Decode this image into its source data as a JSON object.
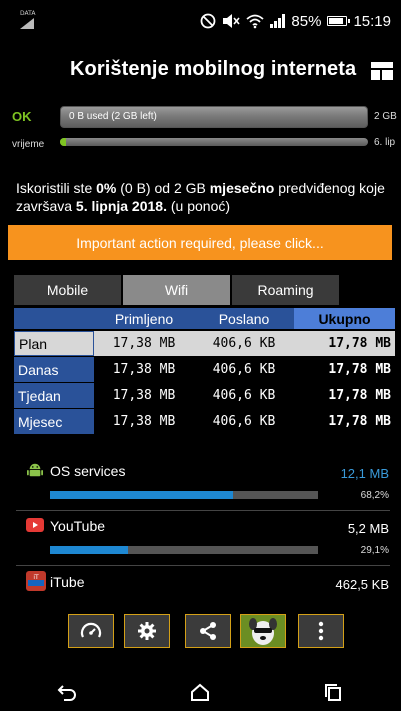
{
  "status_bar": {
    "data_label": "DATA",
    "battery": "85%",
    "battery_level": 0.85,
    "time": "15:19",
    "icons": [
      "data-icon",
      "do-not-disturb-icon",
      "mute-icon",
      "wifi-icon",
      "signal-icon",
      "battery-icon"
    ]
  },
  "header": {
    "title": "Korištenje mobilnog interneta",
    "menu_icon": "layout-icon"
  },
  "usage": {
    "status": "OK",
    "used_text": "0 B used (2 GB left)",
    "limit": "2 GB",
    "time_label": "vrijeme",
    "time_end": "6. lip",
    "used_fraction": 0.0,
    "time_fraction": 0.0
  },
  "description": {
    "part1": "Iskoristili ste ",
    "percent": "0%",
    "part2": " (0 B) od 2 GB ",
    "period": "mjesečno",
    "part3": " predviđenog koje završava ",
    "end_date": "5. lipnja 2018.",
    "part4": " (u ponoć)"
  },
  "action_banner": "Important action required, please click...",
  "tabs": [
    {
      "label": "Mobile",
      "active": false
    },
    {
      "label": "Wifi",
      "active": true
    },
    {
      "label": "Roaming",
      "active": false
    }
  ],
  "table": {
    "headers": [
      "",
      "Primljeno",
      "Poslano",
      "Ukupno"
    ],
    "rows": [
      {
        "label": "Plan",
        "received": "17,38 MB",
        "sent": "406,6 KB",
        "total": "17,78 MB",
        "selected": true
      },
      {
        "label": "Danas",
        "received": "17,38 MB",
        "sent": "406,6 KB",
        "total": "17,78 MB",
        "selected": false
      },
      {
        "label": "Tjedan",
        "received": "17,38 MB",
        "sent": "406,6 KB",
        "total": "17,78 MB",
        "selected": false
      },
      {
        "label": "Mjesec",
        "received": "17,38 MB",
        "sent": "406,6 KB",
        "total": "17,78 MB",
        "selected": false
      }
    ]
  },
  "apps": [
    {
      "name": "OS services",
      "value": "12,1 MB",
      "percent": "68,2%",
      "fraction": 0.682,
      "icon": "android-icon",
      "value_color": "#3a9ad9"
    },
    {
      "name": "YouTube",
      "value": "5,2 MB",
      "percent": "29,1%",
      "fraction": 0.291,
      "icon": "youtube-icon",
      "value_color": "#ffffff"
    },
    {
      "name": "iTube",
      "value": "462,5 KB",
      "icon": "itube-icon",
      "value_color": "#ffffff"
    }
  ],
  "toolbar": {
    "buttons": [
      "speedometer-icon",
      "settings-gear-icon",
      "share-icon",
      "dog-app-icon",
      "more-vert-icon"
    ]
  },
  "navbar": {
    "buttons": [
      "back-icon",
      "home-icon",
      "recents-icon"
    ]
  }
}
